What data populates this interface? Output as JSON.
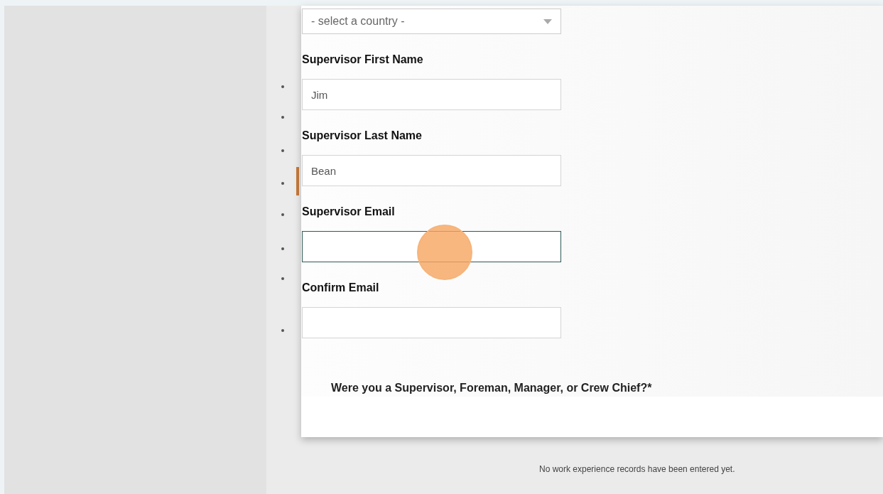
{
  "form": {
    "country_select": {
      "placeholder": "- select a country -"
    },
    "fields": [
      {
        "label": "Supervisor First Name",
        "value": "Jim",
        "focused": false
      },
      {
        "label": "Supervisor Last Name",
        "value": "Bean",
        "focused": false
      },
      {
        "label": "Supervisor Email",
        "focused": true
      },
      {
        "label": "Confirm Email",
        "focused": false
      }
    ],
    "question": "Were you a Supervisor, Foreman, Manager, or Crew Chief?*"
  },
  "empty_message": "No work experience records have been entered yet."
}
